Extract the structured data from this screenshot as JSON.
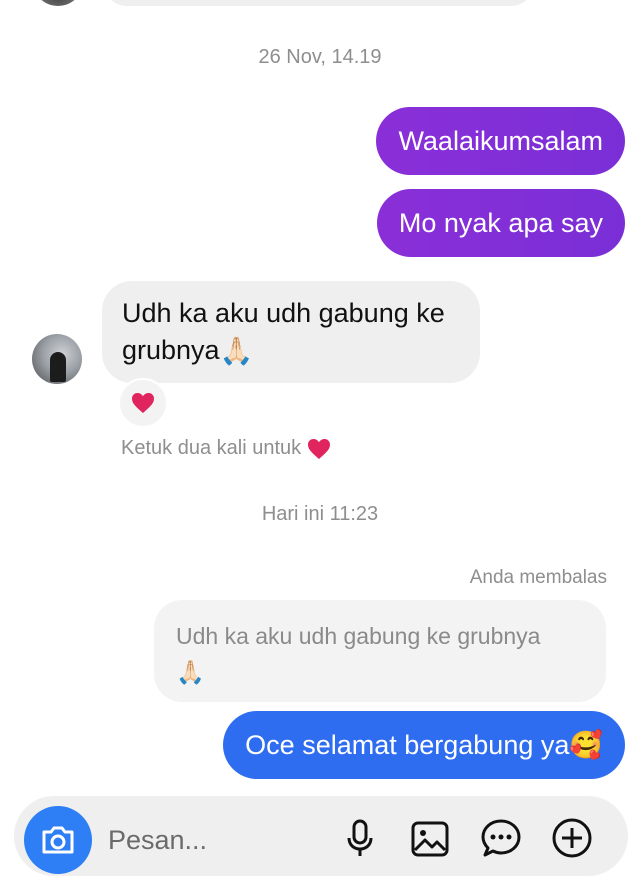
{
  "conversation": {
    "timestamps": [
      "26 Nov, 14.19",
      "Hari ini 11:23"
    ],
    "outgoing_1": "Waalaikumsalam",
    "outgoing_2": "Mo nyak apa say",
    "incoming_message": "Udh ka aku udh gabung ke grubnya",
    "incoming_emoji": "🙏🏻",
    "reaction_emoji": "❤️",
    "double_tap_hint": "Ketuk dua kali untuk",
    "reply_label": "Anda membalas",
    "reply_quote_text": "Udh ka aku udh gabung ke grubnya",
    "reply_quote_emoji": "🙏🏻",
    "outgoing_3": "Oce selamat bergabung ya",
    "outgoing_3_emoji": "🥰"
  },
  "composer": {
    "placeholder": "Pesan...",
    "icons": [
      "camera-icon",
      "microphone-icon",
      "gallery-icon",
      "sticker-icon",
      "add-icon"
    ]
  },
  "colors": {
    "purple_bubble": "#7f2fd6",
    "blue_bubble": "#2f6df0",
    "camera_button": "#2e7ff5",
    "incoming_bubble": "#efefef",
    "meta_text": "#8e8e8e",
    "heart": "#e0245e"
  }
}
